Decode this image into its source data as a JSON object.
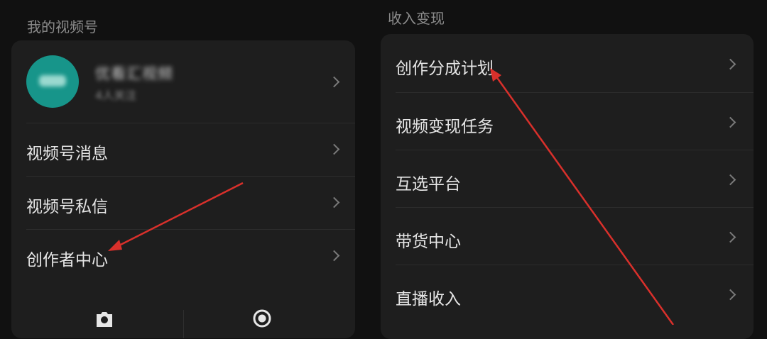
{
  "left": {
    "section_title": "我的视频号",
    "profile": {
      "name": "优看汇视频",
      "sub": "4人关注"
    },
    "items": [
      {
        "label": "视频号消息"
      },
      {
        "label": "视频号私信"
      },
      {
        "label": "创作者中心"
      }
    ],
    "bottom_icons": [
      "camera-icon",
      "record-icon"
    ]
  },
  "right": {
    "section_title": "收入变现",
    "items": [
      {
        "label": "创作分成计划"
      },
      {
        "label": "视频变现任务"
      },
      {
        "label": "互选平台"
      },
      {
        "label": "带货中心"
      },
      {
        "label": "直播收入"
      }
    ]
  },
  "colors": {
    "background": "#111111",
    "card": "#1e1e1e",
    "avatar": "#17958a",
    "annotation_arrow": "#d9302b"
  }
}
